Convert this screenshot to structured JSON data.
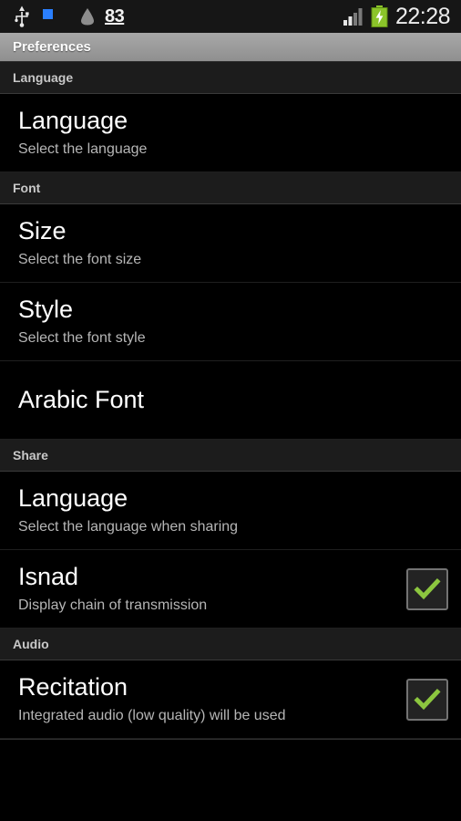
{
  "statusbar": {
    "usb_icon": "usb-icon",
    "indicator_icon": "blue-square-indicator-icon",
    "droplet_icon": "droplet-icon",
    "notification_count": "83",
    "signal_icon": "signal-bars-icon",
    "battery_icon": "battery-charging-icon",
    "clock": "22:28",
    "colors": {
      "battery_green": "#8bc42a",
      "indicator_blue": "#2a7fff"
    }
  },
  "titlebar": {
    "title": "Preferences"
  },
  "sections": [
    {
      "header": "Language",
      "rows": [
        {
          "title": "Language",
          "subtitle": "Select the language",
          "widget": "none"
        }
      ]
    },
    {
      "header": "Font",
      "rows": [
        {
          "title": "Size",
          "subtitle": "Select the font size",
          "widget": "none"
        },
        {
          "title": "Style",
          "subtitle": "Select the font style",
          "widget": "none"
        },
        {
          "title": "Arabic Font",
          "subtitle": "",
          "widget": "none"
        }
      ]
    },
    {
      "header": "Share",
      "rows": [
        {
          "title": "Language",
          "subtitle": "Select the language when sharing",
          "widget": "none"
        },
        {
          "title": "Isnad",
          "subtitle": "Display chain of transmission",
          "widget": "checkbox",
          "checked": true
        }
      ]
    },
    {
      "header": "Audio",
      "rows": [
        {
          "title": "Recitation",
          "subtitle": "Integrated audio (low quality) will be used",
          "widget": "checkbox",
          "checked": true
        }
      ]
    }
  ],
  "theme": {
    "checkmark_green": "#8cc63f",
    "accent_gray": "#9d9d9d"
  }
}
